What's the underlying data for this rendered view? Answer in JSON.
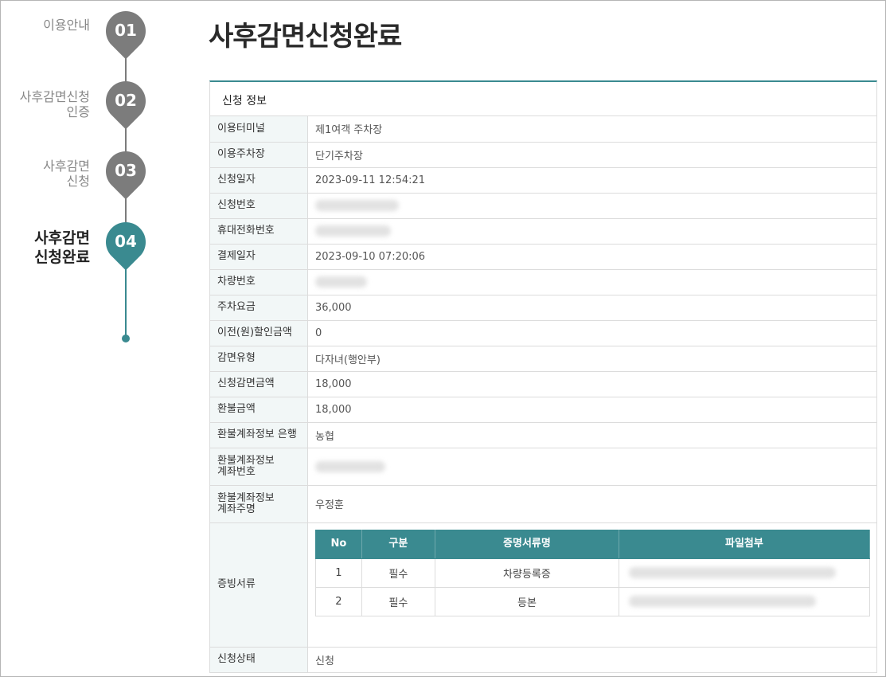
{
  "steps": [
    {
      "num": "01",
      "label": "이용안내"
    },
    {
      "num": "02",
      "label_line1": "사후감면신청",
      "label_line2": "인증"
    },
    {
      "num": "03",
      "label_line1": "사후감면",
      "label_line2": "신청"
    },
    {
      "num": "04",
      "label_line1": "사후감면",
      "label_line2": "신청완료"
    }
  ],
  "page": {
    "title": "사후감면신청완료"
  },
  "panel": {
    "title": "신청 정보"
  },
  "fields": {
    "terminal": {
      "label": "이용터미널",
      "value": "제1여객 주차장"
    },
    "parking": {
      "label": "이용주차장",
      "value": "단기주차장"
    },
    "apply_date": {
      "label": "신청일자",
      "value": "2023-09-11 12:54:21"
    },
    "apply_no": {
      "label": "신청번호"
    },
    "phone": {
      "label": "휴대전화번호"
    },
    "pay_date": {
      "label": "결제일자",
      "value": "2023-09-10 07:20:06"
    },
    "car_no": {
      "label": "차량번호"
    },
    "fee": {
      "label": "주차요금",
      "value": "36,000"
    },
    "prev_discount": {
      "label": "이전(원)할인금액",
      "value": "0"
    },
    "discount_type": {
      "label": "감면유형",
      "value": "다자녀(행안부)"
    },
    "discount_amount": {
      "label": "신청감면금액",
      "value": "18,000"
    },
    "refund_amount": {
      "label": "환불금액",
      "value": "18,000"
    },
    "refund_bank": {
      "label": "환불계좌정보 은행",
      "value": "농협"
    },
    "refund_account": {
      "label_line1": "환불계좌정보",
      "label_line2": "계좌번호"
    },
    "refund_holder": {
      "label_line1": "환불계좌정보",
      "label_line2": "계좌주명",
      "value": "우정훈"
    },
    "docs": {
      "label": "증빙서류"
    },
    "status": {
      "label": "신청상태",
      "value": "신청"
    }
  },
  "docs_table": {
    "headers": [
      "No",
      "구분",
      "증명서류명",
      "파일첨부"
    ],
    "rows": [
      {
        "no": "1",
        "type": "필수",
        "name": "차량등록증"
      },
      {
        "no": "2",
        "type": "필수",
        "name": "등본"
      }
    ]
  },
  "colors": {
    "accent": "#3a8a90",
    "inactive": "#7c7c7c"
  }
}
